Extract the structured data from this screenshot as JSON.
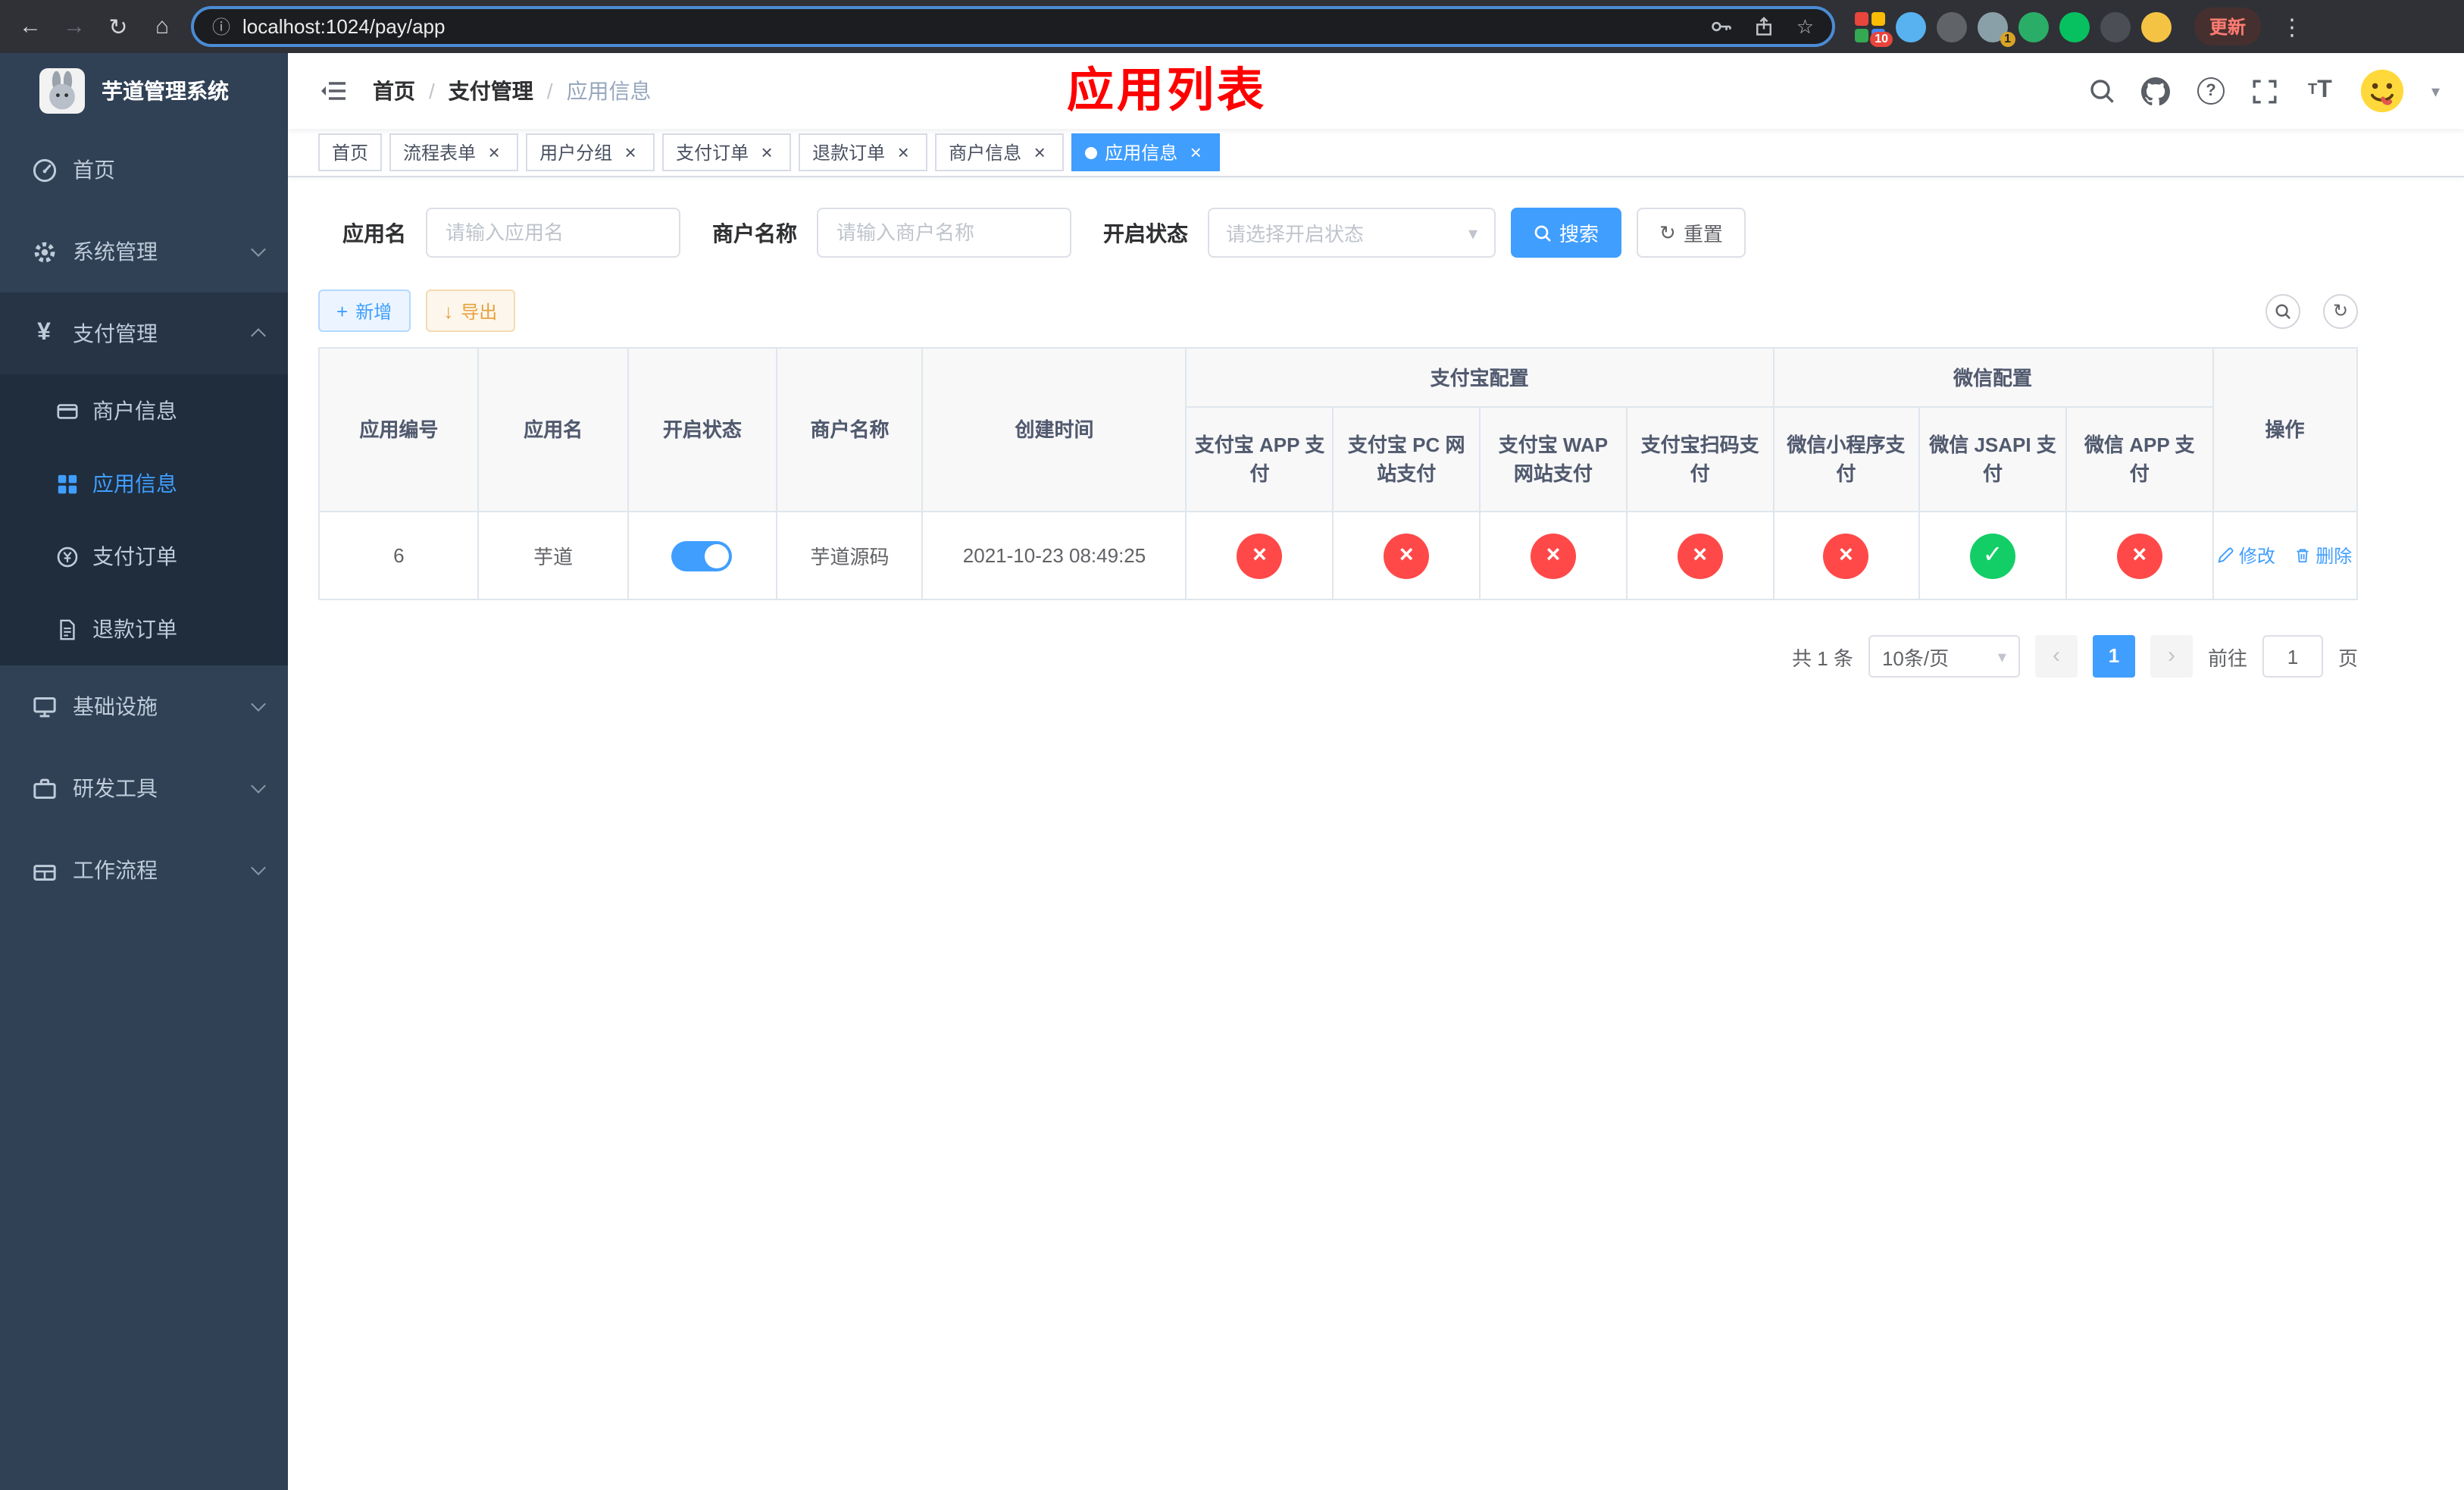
{
  "browser": {
    "url": "localhost:1024/pay/app",
    "update_label": "更新",
    "badges": {
      "b1": "10",
      "b2": "1"
    }
  },
  "icons": {
    "back": "←",
    "forward": "→",
    "reload": "↻",
    "home": "⌂",
    "info": "ⓘ",
    "star": "☆",
    "more": "⋮",
    "yen": "¥",
    "question": "?",
    "caret_down": "▾",
    "close": "×",
    "cross": "×",
    "check": "✓",
    "prev": "‹",
    "next": "›",
    "plus": "+",
    "download": "↓",
    "refresh": "↻",
    "font_big": "T",
    "font_small": "T"
  },
  "sidebar": {
    "title": "芋道管理系统",
    "items": {
      "home": "首页",
      "system": "系统管理",
      "pay": "支付管理",
      "infra": "基础设施",
      "dev": "研发工具",
      "workflow": "工作流程"
    },
    "pay_children": {
      "merchant": "商户信息",
      "app": "应用信息",
      "order": "支付订单",
      "refund": "退款订单"
    }
  },
  "header": {
    "breadcrumb": [
      "首页",
      "支付管理",
      "应用信息"
    ],
    "page_title": "应用列表"
  },
  "tabs": [
    {
      "label": "首页",
      "closable": false,
      "active": false
    },
    {
      "label": "流程表单",
      "closable": true,
      "active": false
    },
    {
      "label": "用户分组",
      "closable": true,
      "active": false
    },
    {
      "label": "支付订单",
      "closable": true,
      "active": false
    },
    {
      "label": "退款订单",
      "closable": true,
      "active": false
    },
    {
      "label": "商户信息",
      "closable": true,
      "active": false
    },
    {
      "label": "应用信息",
      "closable": true,
      "active": true
    }
  ],
  "filters": {
    "app_name": {
      "label": "应用名",
      "placeholder": "请输入应用名",
      "value": ""
    },
    "merchant_name": {
      "label": "商户名称",
      "placeholder": "请输入商户名称",
      "value": ""
    },
    "status": {
      "label": "开启状态",
      "placeholder": "请选择开启状态",
      "value": ""
    },
    "search_label": "搜索",
    "reset_label": "重置"
  },
  "toolbar": {
    "add_label": "新增",
    "export_label": "导出"
  },
  "table": {
    "headers": {
      "id": "应用编号",
      "name": "应用名",
      "status": "开启状态",
      "merchant": "商户名称",
      "created": "创建时间",
      "alipay_group": "支付宝配置",
      "wechat_group": "微信配置",
      "alipay_app": "支付宝 APP 支付",
      "alipay_pc": "支付宝 PC 网站支付",
      "alipay_wap": "支付宝 WAP 网站支付",
      "alipay_qr": "支付宝扫码支付",
      "wx_mini": "微信小程序支付",
      "wx_jsapi": "微信 JSAPI 支付",
      "wx_app": "微信 APP 支付",
      "actions": "操作"
    },
    "rows": [
      {
        "id": "6",
        "name": "芋道",
        "enabled": true,
        "merchant": "芋道源码",
        "created": "2021-10-23 08:49:25",
        "alipay_app": false,
        "alipay_pc": false,
        "alipay_wap": false,
        "alipay_qr": false,
        "wx_mini": false,
        "wx_jsapi": true,
        "wx_app": false,
        "edit_label": "修改",
        "delete_label": "删除"
      }
    ]
  },
  "pagination": {
    "total": "共 1 条",
    "page_size": "10条/页",
    "current_page": "1",
    "goto_label": "前往",
    "goto_value": "1",
    "page_unit": "页"
  }
}
